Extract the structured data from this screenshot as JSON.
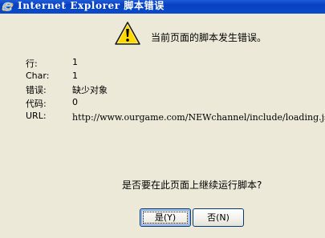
{
  "window": {
    "title": "Internet Explorer 脚本错误"
  },
  "message": "当前页面的脚本发生错误。",
  "details": [
    {
      "label": "行:",
      "value": "1"
    },
    {
      "label": "Char:",
      "value": "1"
    },
    {
      "label": "错误:",
      "value": "缺少对象"
    },
    {
      "label": "代码:",
      "value": "0"
    },
    {
      "label": "URL:",
      "value": "http://www.ourgame.com/NEWchannel/include/loading.js"
    }
  ],
  "question": "是否要在此页面上继续运行脚本?",
  "buttons": {
    "yes_label": "是(Y)",
    "no_label": "否(N)"
  },
  "icons": {
    "title": "ie-logo-icon",
    "message": "warning-icon"
  },
  "colors": {
    "titlebar": "#0A3FC4",
    "dialog_background": "#ECE9D8",
    "warning_yellow": "#FFD800"
  }
}
